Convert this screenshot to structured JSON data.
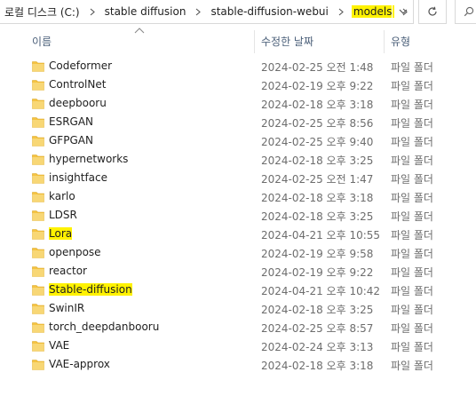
{
  "address_bar": {
    "crumbs": [
      {
        "label": "로컬 디스크 (C:)",
        "highlighted": false
      },
      {
        "label": "stable diffusion",
        "highlighted": false
      },
      {
        "label": "stable-diffusion-webui",
        "highlighted": false
      },
      {
        "label": "models",
        "highlighted": true
      }
    ]
  },
  "columns": {
    "name": "이름",
    "date": "수정한 날짜",
    "type": "유형"
  },
  "colors": {
    "highlight": "#fff200",
    "folder": "#f5c342",
    "header_text": "#4c607a"
  },
  "files": [
    {
      "name": "Codeformer",
      "date": "2024-02-25 오전 1:48",
      "type": "파일 폴더",
      "highlighted": false
    },
    {
      "name": "ControlNet",
      "date": "2024-02-19 오후 9:22",
      "type": "파일 폴더",
      "highlighted": false
    },
    {
      "name": "deepbooru",
      "date": "2024-02-18 오후 3:18",
      "type": "파일 폴더",
      "highlighted": false
    },
    {
      "name": "ESRGAN",
      "date": "2024-02-25 오후 8:56",
      "type": "파일 폴더",
      "highlighted": false
    },
    {
      "name": "GFPGAN",
      "date": "2024-02-25 오후 9:40",
      "type": "파일 폴더",
      "highlighted": false
    },
    {
      "name": "hypernetworks",
      "date": "2024-02-18 오후 3:25",
      "type": "파일 폴더",
      "highlighted": false
    },
    {
      "name": "insightface",
      "date": "2024-02-25 오전 1:47",
      "type": "파일 폴더",
      "highlighted": false
    },
    {
      "name": "karlo",
      "date": "2024-02-18 오후 3:18",
      "type": "파일 폴더",
      "highlighted": false
    },
    {
      "name": "LDSR",
      "date": "2024-02-18 오후 3:25",
      "type": "파일 폴더",
      "highlighted": false
    },
    {
      "name": "Lora",
      "date": "2024-04-21 오후 10:55",
      "type": "파일 폴더",
      "highlighted": true
    },
    {
      "name": "openpose",
      "date": "2024-02-19 오후 9:58",
      "type": "파일 폴더",
      "highlighted": false
    },
    {
      "name": "reactor",
      "date": "2024-02-19 오후 9:22",
      "type": "파일 폴더",
      "highlighted": false
    },
    {
      "name": "Stable-diffusion",
      "date": "2024-04-21 오후 10:42",
      "type": "파일 폴더",
      "highlighted": true
    },
    {
      "name": "SwinIR",
      "date": "2024-02-18 오후 3:25",
      "type": "파일 폴더",
      "highlighted": false
    },
    {
      "name": "torch_deepdanbooru",
      "date": "2024-02-25 오후 8:57",
      "type": "파일 폴더",
      "highlighted": false
    },
    {
      "name": "VAE",
      "date": "2024-02-24 오후 3:13",
      "type": "파일 폴더",
      "highlighted": false
    },
    {
      "name": "VAE-approx",
      "date": "2024-02-18 오후 3:18",
      "type": "파일 폴더",
      "highlighted": false
    }
  ]
}
